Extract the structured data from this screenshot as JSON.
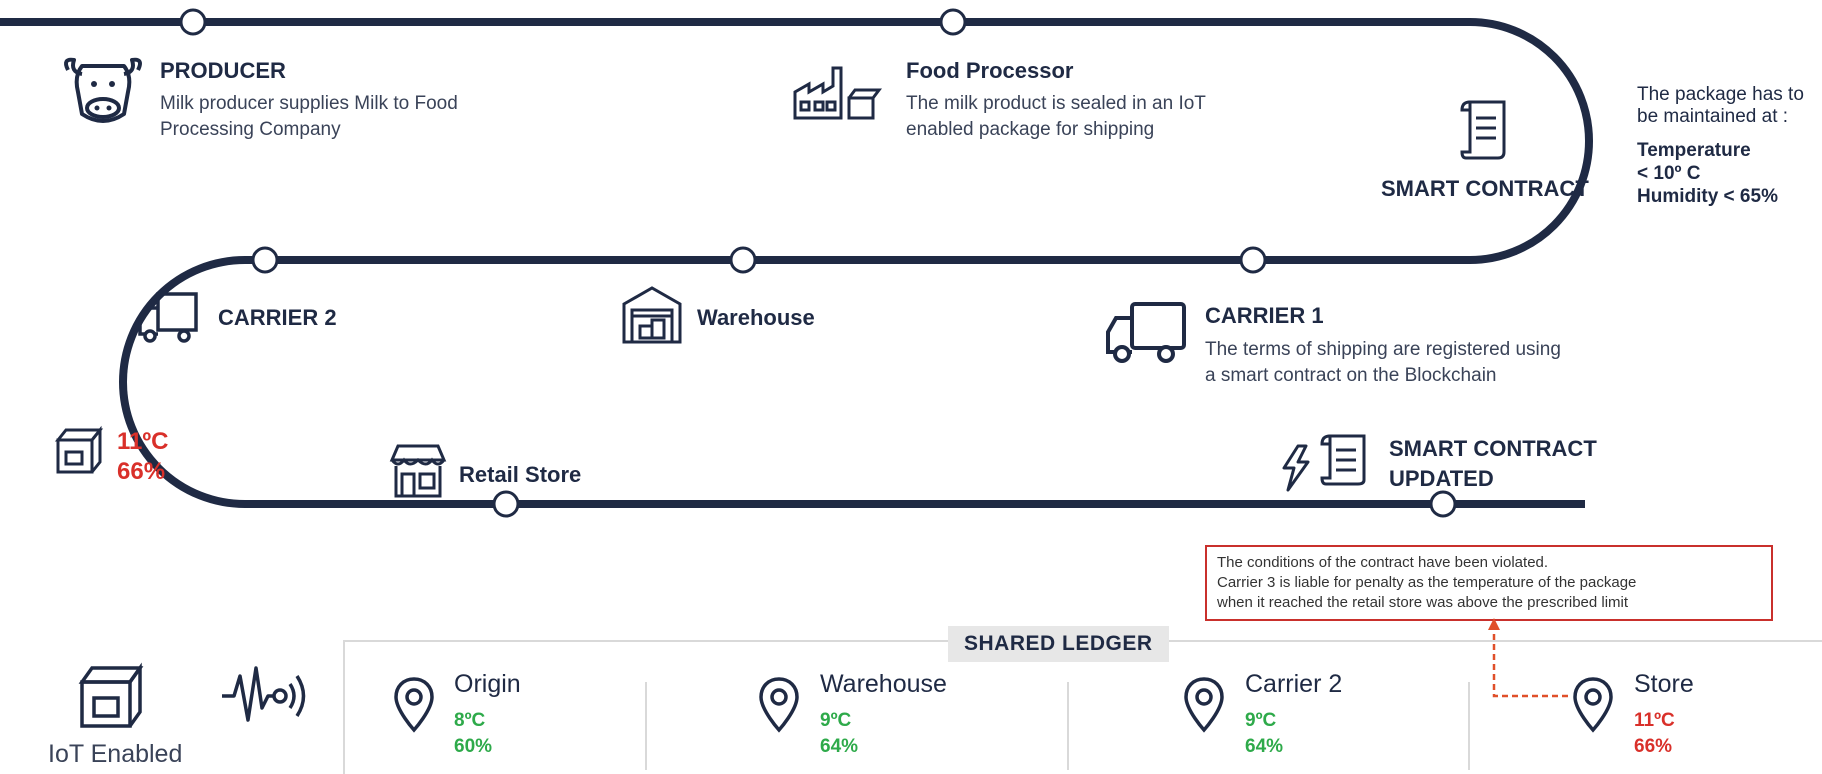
{
  "stages": {
    "producer": {
      "title": "PRODUCER",
      "desc_line1": "Milk producer supplies Milk to Food",
      "desc_line2": "Processing Company"
    },
    "processor": {
      "title": "Food Processor",
      "desc_line1": "The milk product is sealed in an IoT",
      "desc_line2": "enabled package for shipping"
    },
    "smart_contract": {
      "title": "SMART CONTRACT"
    },
    "carrier1": {
      "title": "CARRIER 1",
      "desc_line1": "The terms of shipping are registered using",
      "desc_line2": "a smart contract on the Blockchain"
    },
    "warehouse": {
      "title": "Warehouse"
    },
    "carrier2": {
      "title": "CARRIER 2"
    },
    "package_reading": {
      "temp": "11ºC",
      "humidity": "66%"
    },
    "retail": {
      "title": "Retail Store"
    },
    "contract_updated": {
      "line1": "SMART CONTRACT",
      "line2": "UPDATED"
    }
  },
  "conditions": {
    "line1": "The package has to",
    "line2": "be maintained at :",
    "temp_label": "Temperature",
    "temp_value": "< 10º C",
    "humidity": "Humidity < 65%"
  },
  "alert": {
    "line1": "The conditions of the contract have been violated.",
    "line2": "Carrier 3 is liable for penalty as the temperature of the package",
    "line3": "when it reached the retail store was above the prescribed limit"
  },
  "iot": {
    "label": "IoT Enabled"
  },
  "ledger": {
    "title": "SHARED LEDGER",
    "entries": [
      {
        "name": "Origin",
        "temp": "8ºC",
        "humidity": "60%",
        "status": "ok"
      },
      {
        "name": "Warehouse",
        "temp": "9ºC",
        "humidity": "64%",
        "status": "ok"
      },
      {
        "name": "Carrier 2",
        "temp": "9ºC",
        "humidity": "64%",
        "status": "ok"
      },
      {
        "name": "Store",
        "temp": "11ºC",
        "humidity": "66%",
        "status": "violation"
      }
    ]
  },
  "colors": {
    "path": "#1f2a44",
    "alert": "#d9302a",
    "ok": "#2eaa4a",
    "alert_arrow": "#e0502a"
  }
}
